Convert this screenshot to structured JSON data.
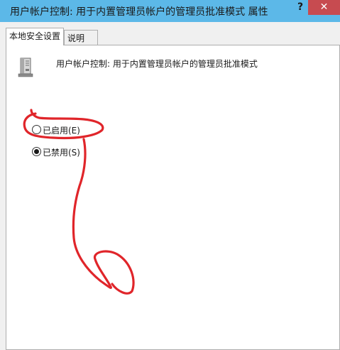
{
  "window": {
    "title": "用户帐户控制: 用于内置管理员帐户的管理员批准模式 属性",
    "help_label": "?",
    "close_label": "✕"
  },
  "tabs": [
    {
      "label": "本地安全设置",
      "active": true
    },
    {
      "label": "说明",
      "active": false
    }
  ],
  "policy": {
    "icon": "server-icon",
    "name": "用户帐户控制: 用于内置管理员帐户的管理员批准模式"
  },
  "options": [
    {
      "label": "已启用(E)",
      "selected": false
    },
    {
      "label": "已禁用(S)",
      "selected": true
    }
  ],
  "colors": {
    "titlebar": "#5cb8e8",
    "close_button": "#c74b50",
    "annotation": "#e0252a"
  }
}
